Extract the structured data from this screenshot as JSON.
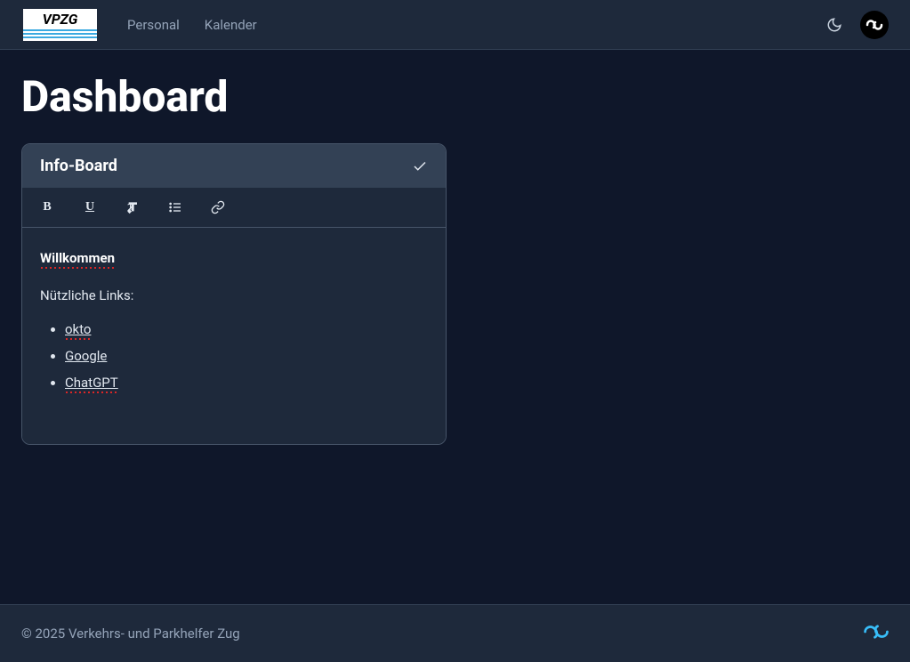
{
  "nav": {
    "logo_text": "VPZG",
    "links": [
      "Personal",
      "Kalender"
    ]
  },
  "page": {
    "title": "Dashboard"
  },
  "card": {
    "title": "Info-Board",
    "body": {
      "heading": "Willkommen",
      "subtext": "Nützliche Links:",
      "links": [
        "okto",
        "Google",
        "ChatGPT"
      ]
    }
  },
  "footer": {
    "text": "© 2025 Verkehrs- und Parkhelfer Zug"
  }
}
